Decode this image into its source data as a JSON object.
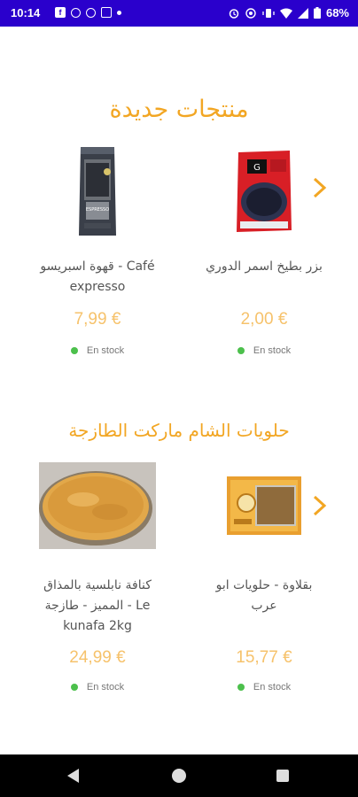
{
  "status_bar": {
    "time": "10:14",
    "battery": "68%"
  },
  "sections": [
    {
      "title": "منتجات جديدة",
      "products": [
        {
          "name": "بزر بطيخ اسمر الدوري",
          "price": "2,00 €",
          "stock": "En stock",
          "image": "seeds-package"
        },
        {
          "name": "قهوة اسبريسو - Café expresso",
          "price": "7,99 €",
          "stock": "En stock",
          "image": "coffee-bag"
        }
      ]
    },
    {
      "title": "حلويات الشام ماركت الطازجة",
      "products": [
        {
          "name": "بقلاوة - حلويات ابو عرب",
          "price": "15,77 €",
          "stock": "En stock",
          "image": "baklava-box"
        },
        {
          "name": "كنافة نابلسية بالمذاق المميز - طازجة - Le kunafa 2kg",
          "price": "24,99 €",
          "stock": "En stock",
          "image": "kunafa-tray"
        }
      ]
    }
  ],
  "colors": {
    "accent": "#f2a623",
    "price": "#f6c26b",
    "in_stock": "#4cc04c",
    "status_bar": "#2a00cc"
  }
}
